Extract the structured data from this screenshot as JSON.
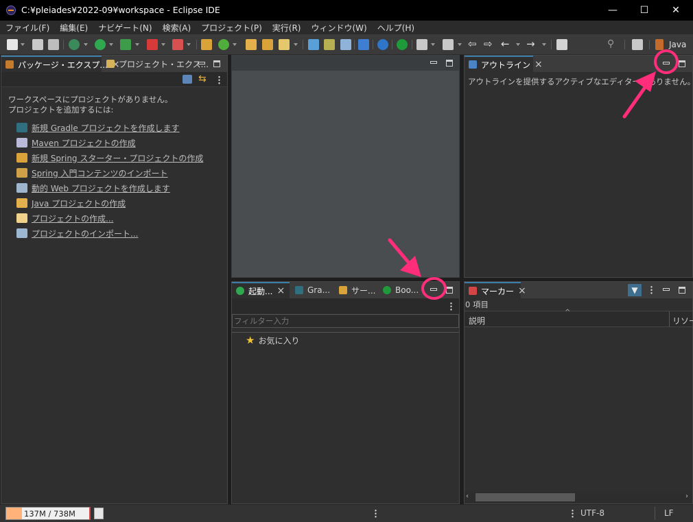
{
  "window": {
    "title": "C:¥pleiades¥2022-09¥workspace - Eclipse IDE",
    "minimize": "—",
    "maximize": "☐",
    "close": "✕"
  },
  "menu": [
    "ファイル(F)",
    "編集(E)",
    "ナビゲート(N)",
    "検索(A)",
    "プロジェクト(P)",
    "実行(R)",
    "ウィンドウ(W)",
    "ヘルプ(H)"
  ],
  "toolbar": {
    "perspective_label": "Java",
    "search_icon": "search-icon"
  },
  "left_panel": {
    "tabs": [
      "パッケージ・エクスプ...",
      "プロジェクト・エクス..."
    ],
    "message_line1": "ワークスペースにプロジェクトがありません。",
    "message_line2": "プロジェクトを追加するには:",
    "links": [
      "新規 Gradle プロジェクトを作成します",
      "Maven プロジェクトの作成",
      "新規 Spring スターター・プロジェクトの作成",
      "Spring 入門コンテンツのインポート",
      "動的 Web プロジェクトを作成します",
      "Java プロジェクトの作成",
      "プロジェクトの作成...",
      "プロジェクトのインポート..."
    ]
  },
  "outline_panel": {
    "tab": "アウトライン",
    "message": "アウトラインを提供するアクティブなエディターがありません。"
  },
  "bottom_center_panel": {
    "tabs": [
      "起動...",
      "Gra...",
      "サー...",
      "Boo..."
    ],
    "filter_placeholder": "フィルター入力",
    "tree_item": "お気に入り"
  },
  "markers_panel": {
    "tab": "マーカー",
    "count": "0 項目",
    "col_description": "説明",
    "col_resource": "リソース"
  },
  "status": {
    "heap": "137M / 738M",
    "heap_used_fraction": 0.186,
    "encoding": "UTF-8",
    "line_ending": "LF"
  },
  "colors": {
    "accent": "#3c7ea8",
    "annotation": "#ff2d7a",
    "heap_fill": "#ffb37a"
  }
}
